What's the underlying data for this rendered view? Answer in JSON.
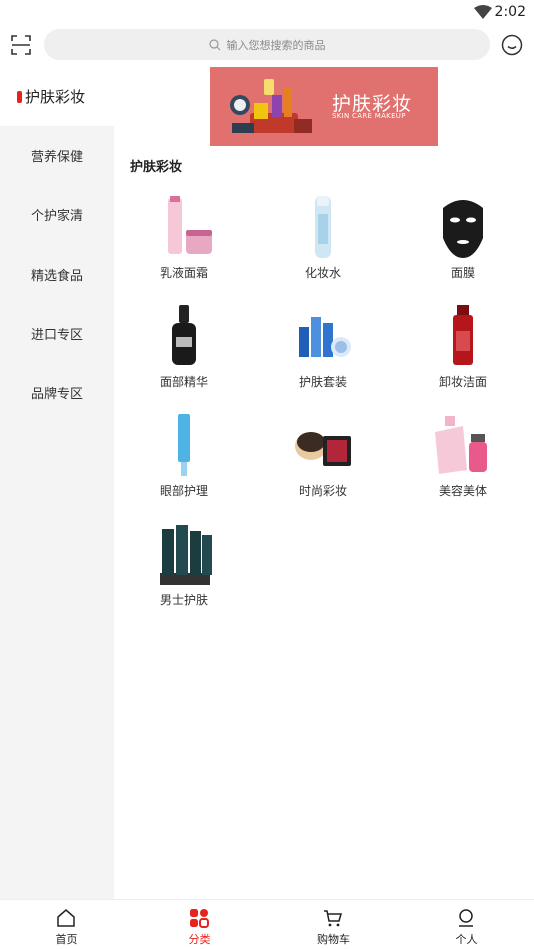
{
  "status_bar": {
    "time": "2:02"
  },
  "search": {
    "placeholder": "输入您想搜索的商品"
  },
  "sidebar": {
    "items": [
      {
        "label": "护肤彩妆"
      },
      {
        "label": "营养保健"
      },
      {
        "label": "个护家清"
      },
      {
        "label": "精选食品"
      },
      {
        "label": "进口专区"
      },
      {
        "label": "品牌专区"
      }
    ]
  },
  "banner": {
    "title": "护肤彩妆",
    "subtitle": "SKIN CARE MAKEUP"
  },
  "section": {
    "title": "护肤彩妆"
  },
  "categories": [
    {
      "label": "乳液面霜",
      "icon": "lotion-cream-icon"
    },
    {
      "label": "化妆水",
      "icon": "toner-icon"
    },
    {
      "label": "面膜",
      "icon": "face-mask-icon"
    },
    {
      "label": "面部精华",
      "icon": "serum-icon"
    },
    {
      "label": "护肤套装",
      "icon": "skincare-set-icon"
    },
    {
      "label": "卸妆洁面",
      "icon": "cleanser-icon"
    },
    {
      "label": "眼部护理",
      "icon": "eye-care-icon"
    },
    {
      "label": "时尚彩妆",
      "icon": "makeup-icon"
    },
    {
      "label": "美容美体",
      "icon": "perfume-icon"
    },
    {
      "label": "男士护肤",
      "icon": "men-skincare-icon"
    }
  ],
  "tabs": [
    {
      "label": "首页",
      "icon": "home-icon"
    },
    {
      "label": "分类",
      "icon": "category-icon"
    },
    {
      "label": "购物车",
      "icon": "cart-icon"
    },
    {
      "label": "个人",
      "icon": "profile-icon"
    }
  ],
  "colors": {
    "accent": "#e8231d",
    "banner": "#e0716f",
    "sidebar_bg": "#f4f4f4",
    "search_bg": "#efefef"
  }
}
